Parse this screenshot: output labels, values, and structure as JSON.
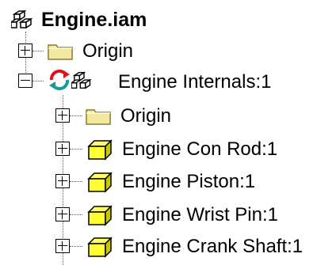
{
  "tree": {
    "root": {
      "label": "Engine.iam",
      "icon": "assembly-icon"
    },
    "nodes": [
      {
        "label": "Origin",
        "icon": "folder-icon",
        "expander": "plus"
      },
      {
        "label": "Engine Internals:1",
        "icon": "subassembly-active-icon",
        "expander": "minus",
        "children": [
          {
            "label": "Origin",
            "icon": "folder-icon",
            "expander": "plus"
          },
          {
            "label": "Engine Con Rod:1",
            "icon": "part-icon",
            "expander": "plus"
          },
          {
            "label": "Engine Piston:1",
            "icon": "part-icon",
            "expander": "plus"
          },
          {
            "label": "Engine Wrist Pin:1",
            "icon": "part-icon",
            "expander": "plus"
          },
          {
            "label": "Engine Crank Shaft:1",
            "icon": "part-icon",
            "expander": "plus"
          }
        ]
      }
    ]
  },
  "colors": {
    "folder": "#f3e9a0",
    "part": "#ffff33",
    "update_red": "#e0101a",
    "update_teal": "#159a9c"
  }
}
